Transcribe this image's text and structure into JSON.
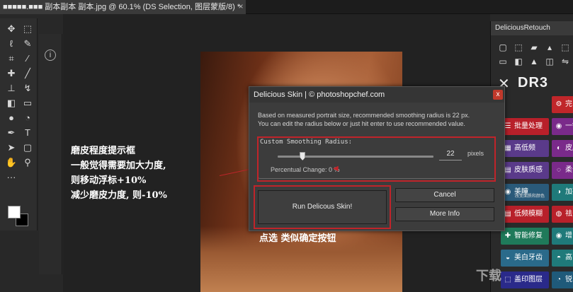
{
  "document_tab": {
    "title": "■■■■■.■■■ 副本副本 副本.jpg @ 60.1% (DS Selection, 图层蒙版/8) *",
    "close": "×"
  },
  "toolbar": {
    "tools": [
      {
        "name": "move-tool-icon",
        "glyph": "✥"
      },
      {
        "name": "marquee-tool-icon",
        "glyph": "⬚"
      },
      {
        "name": "lasso-tool-icon",
        "glyph": "ℓ"
      },
      {
        "name": "quick-select-tool-icon",
        "glyph": "✎"
      },
      {
        "name": "crop-tool-icon",
        "glyph": "⌗"
      },
      {
        "name": "eyedropper-tool-icon",
        "glyph": "⁄"
      },
      {
        "name": "healing-brush-tool-icon",
        "glyph": "✚"
      },
      {
        "name": "brush-tool-icon",
        "glyph": "╱"
      },
      {
        "name": "clone-stamp-tool-icon",
        "glyph": "⊥"
      },
      {
        "name": "history-brush-tool-icon",
        "glyph": "↯"
      },
      {
        "name": "eraser-tool-icon",
        "glyph": "◧"
      },
      {
        "name": "gradient-tool-icon",
        "glyph": "▭"
      },
      {
        "name": "blur-tool-icon",
        "glyph": "●"
      },
      {
        "name": "dodge-tool-icon",
        "glyph": "◔"
      },
      {
        "name": "pen-tool-icon",
        "glyph": "✒"
      },
      {
        "name": "type-tool-icon",
        "glyph": "T"
      },
      {
        "name": "path-select-tool-icon",
        "glyph": "➤"
      },
      {
        "name": "shape-tool-icon",
        "glyph": "▢"
      },
      {
        "name": "hand-tool-icon",
        "glyph": "✋"
      },
      {
        "name": "zoom-tool-icon",
        "glyph": "⚲"
      },
      {
        "name": "more-tools-icon",
        "glyph": "···"
      }
    ]
  },
  "panel_strip": {
    "info_icon": "i"
  },
  "dr_panel": {
    "title": "DeliciousRetouch",
    "logo": "DR3",
    "logo_x": "✕",
    "top_icons": [
      "▢",
      "⬚",
      "▰",
      "▴",
      "⬚",
      "▭",
      "◧",
      "▲",
      "◫",
      "⇋"
    ],
    "buttons": [
      {
        "label": "完",
        "color": "#c0262a",
        "icon": "⚙"
      },
      {
        "label": "批量处理",
        "color": "#b8202a",
        "icon": "☰"
      },
      {
        "label": "一键",
        "color": "#7a2a8a",
        "icon": "◉"
      },
      {
        "label": "高低频",
        "color": "#5a3a8a",
        "icon": "▦"
      },
      {
        "label": "皮肤",
        "color": "#7a2a8a",
        "icon": "◐"
      },
      {
        "label": "皮肤质感",
        "color": "#5a3a8a",
        "icon": "▤"
      },
      {
        "label": "柔化",
        "color": "#7a2a8a",
        "icon": "◌"
      },
      {
        "label": "美瞳",
        "color": "#2a5a7a",
        "icon": "◉"
      },
      {
        "label": "加亮",
        "color": "#1f7a7a",
        "icon": "◑"
      },
      {
        "label": "低频模糊",
        "color": "#b8202a",
        "icon": "▤"
      },
      {
        "label": "祛",
        "color": "#b8202a",
        "icon": "◍"
      },
      {
        "label": "智能修复",
        "color": "#1f7a5a",
        "icon": "✚"
      },
      {
        "label": "增",
        "color": "#1f7a7a",
        "icon": "◉"
      },
      {
        "label": "美白牙齿",
        "color": "#2a6a8a",
        "icon": "◒"
      },
      {
        "label": "高",
        "color": "#1f7a7a",
        "icon": "◓"
      },
      {
        "label": "盖印图层",
        "color": "#2a2a8a",
        "icon": "⬚"
      },
      {
        "label": "锐",
        "color": "#1f5a7a",
        "icon": "◔"
      }
    ],
    "sublabels": {
      "skin": "改变面质和颜色"
    }
  },
  "dialog": {
    "title": "Delicious Skin | © photoshopchef.com",
    "close": "x",
    "description_line1": "Based on measured portrait size, recommended smoothing radius is 22 px.",
    "description_line2": "You can edit the radius below or just hit enter to use recommended value.",
    "group_label": "Custom Smoothing Radius:",
    "radius_value": "22",
    "radius_unit": "pixels",
    "slider_fraction": 0.16,
    "percentual_change": "Percentual Change: 0 %",
    "run_button": "Run Delicous Skin!",
    "cancel_button": "Cancel",
    "more_info_button": "More Info"
  },
  "annotations": {
    "line1": "磨皮程度提示框",
    "line2": "一般觉得需要加大力度,",
    "line3": "则移动浮标+10%",
    "line4": "减少磨皮力度, 则-10%",
    "bottom": "点选 类似确定按钮",
    "accent_color": "#c0242a"
  },
  "watermark": "下载"
}
